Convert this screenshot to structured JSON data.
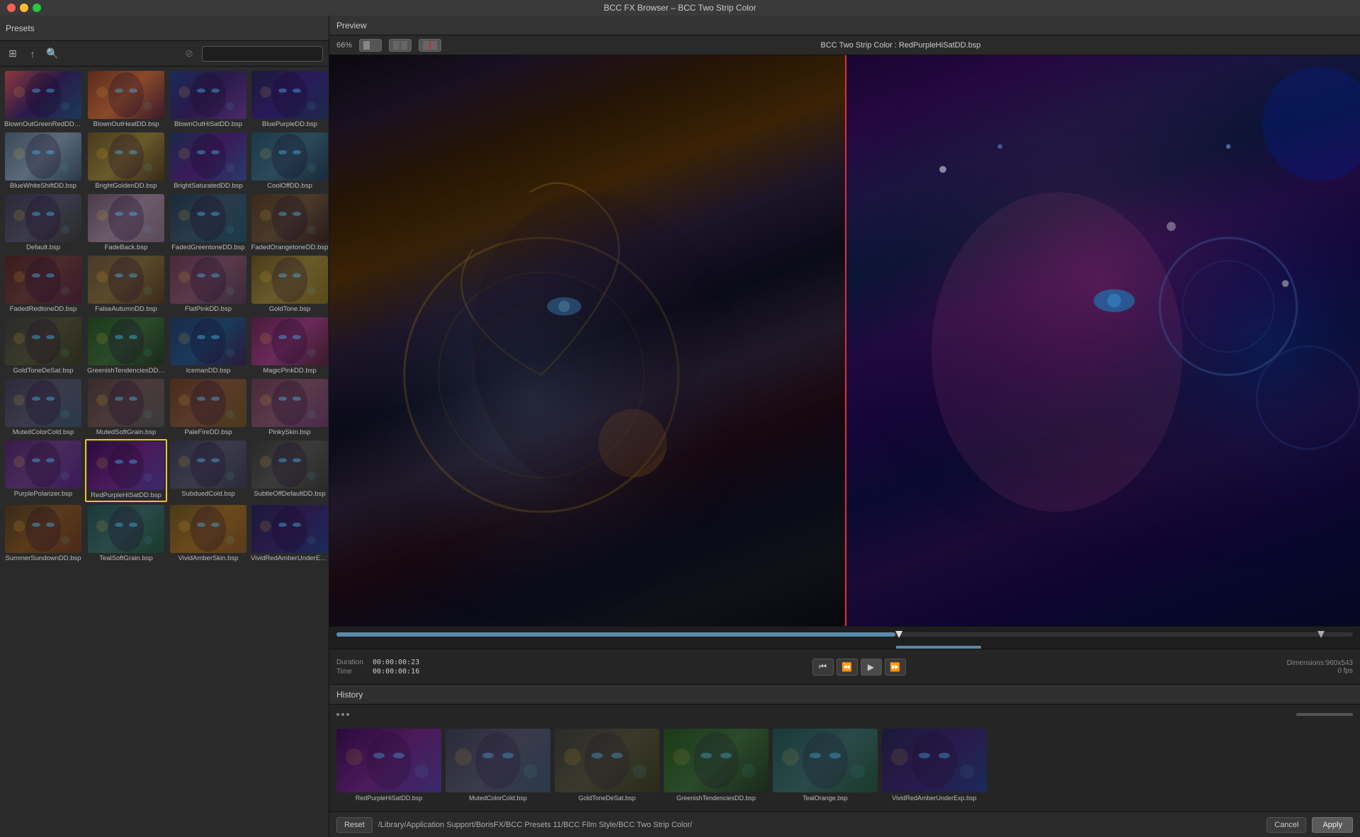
{
  "titlebar": {
    "title": "BCC FX Browser – BCC Two Strip Color"
  },
  "left_panel": {
    "header_label": "Presets",
    "search_placeholder": "",
    "presets": [
      {
        "label": "BlownOutGreenRedDD.bsp",
        "thumb_class": "thumb-blown-green"
      },
      {
        "label": "BlownOutHeatDD.bsp",
        "thumb_class": "thumb-blown-heat"
      },
      {
        "label": "BlownOutHiSatDD.bsp",
        "thumb_class": "thumb-blown-sat"
      },
      {
        "label": "BluePurpleDD.bsp",
        "thumb_class": "thumb-blue-purple"
      },
      {
        "label": "BlueWhiteShiftDD.bsp",
        "thumb_class": "thumb-bluewhite"
      },
      {
        "label": "BrightGoldenDD.bsp",
        "thumb_class": "thumb-bright-golden"
      },
      {
        "label": "BrightSaturatedDD.bsp",
        "thumb_class": "thumb-bright-sat"
      },
      {
        "label": "CoolOffDD.bsp",
        "thumb_class": "thumb-cooloff"
      },
      {
        "label": "Default.bsp",
        "thumb_class": "thumb-default"
      },
      {
        "label": "FadeBack.bsp",
        "thumb_class": "thumb-fadeback"
      },
      {
        "label": "FadedGreentoneDD.bsp",
        "thumb_class": "thumb-fadedgreen"
      },
      {
        "label": "FadedOrangetoneDD.bsp",
        "thumb_class": "thumb-fadedorange"
      },
      {
        "label": "FadedRedtoneDD.bsp",
        "thumb_class": "thumb-fadedredd"
      },
      {
        "label": "FalseAutumnDD.bsp",
        "thumb_class": "thumb-false-autumn"
      },
      {
        "label": "FlatPinkDD.bsp",
        "thumb_class": "thumb-flat-pink"
      },
      {
        "label": "GoldTone.bsp",
        "thumb_class": "thumb-gold-tone"
      },
      {
        "label": "GoldToneDeSat.bsp",
        "thumb_class": "thumb-goldtone-desat"
      },
      {
        "label": "GreenishTendenciesDD.bsp",
        "thumb_class": "thumb-greenish"
      },
      {
        "label": "IcemanDD.bsp",
        "thumb_class": "thumb-iceman"
      },
      {
        "label": "MagicPinkDD.bsp",
        "thumb_class": "thumb-magic-pink"
      },
      {
        "label": "MutedColorCold.bsp",
        "thumb_class": "thumb-muted-cold"
      },
      {
        "label": "MutedSoftGrain.bsp",
        "thumb_class": "thumb-muted-soft"
      },
      {
        "label": "PaleFireDD.bsp",
        "thumb_class": "thumb-pale-fire"
      },
      {
        "label": "PinkySkin.bsp",
        "thumb_class": "thumb-pinky"
      },
      {
        "label": "PurplePolarizer.bsp",
        "thumb_class": "thumb-purple-polar"
      },
      {
        "label": "RedPurpleHiSatDD.bsp",
        "thumb_class": "thumb-red-purple",
        "selected": true
      },
      {
        "label": "SubduedCold.bsp",
        "thumb_class": "thumb-subdued-cold"
      },
      {
        "label": "SubtleOffDefaultDD.bsp",
        "thumb_class": "thumb-subtle-off"
      },
      {
        "label": "SummerSundownDD.bsp",
        "thumb_class": "thumb-summer-sun"
      },
      {
        "label": "TealSoftGrain.bsp",
        "thumb_class": "thumb-teal-soft"
      },
      {
        "label": "VividAmberSkin.bsp",
        "thumb_class": "thumb-vivid-amber"
      },
      {
        "label": "VividRedAmberUnderExp.bsp",
        "thumb_class": "thumb-vivid-red"
      }
    ]
  },
  "preview": {
    "label": "Preview",
    "zoom": "66%",
    "title": "BCC Two Strip Color : RedPurpleHiSatDD.bsp",
    "view_buttons": [
      "split-left",
      "split-center",
      "split-red"
    ]
  },
  "transport": {
    "duration_label": "Duration",
    "duration_value": "00:00:00:23",
    "time_label": "Time",
    "time_value": "00:00:00:16",
    "dimensions": "Dimensions:960x543",
    "fps": "0 fps"
  },
  "history": {
    "label": "History",
    "items": [
      {
        "label": "RedPurpleHiSatDD.bsp",
        "thumb_class": "hthumb-redpurple"
      },
      {
        "label": "MutedColorCold.bsp",
        "thumb_class": "hthumb-mutedcold"
      },
      {
        "label": "GoldToneDeSat.bsp",
        "thumb_class": "hthumb-goldtone"
      },
      {
        "label": "GreenishTendenciesDD.bsp",
        "thumb_class": "hthumb-greenish"
      },
      {
        "label": "TealOrange.bsp",
        "thumb_class": "hthumb-teal"
      },
      {
        "label": "VividRedAmberUnderExp.bsp",
        "thumb_class": "hthumb-vividred"
      }
    ]
  },
  "bottom_bar": {
    "path": "/Library/Application Support/BorisFX/BCC Presets 11/BCC Film Style/BCC Two Strip Color/",
    "reset_label": "Reset",
    "cancel_label": "Cancel",
    "apply_label": "Apply"
  }
}
